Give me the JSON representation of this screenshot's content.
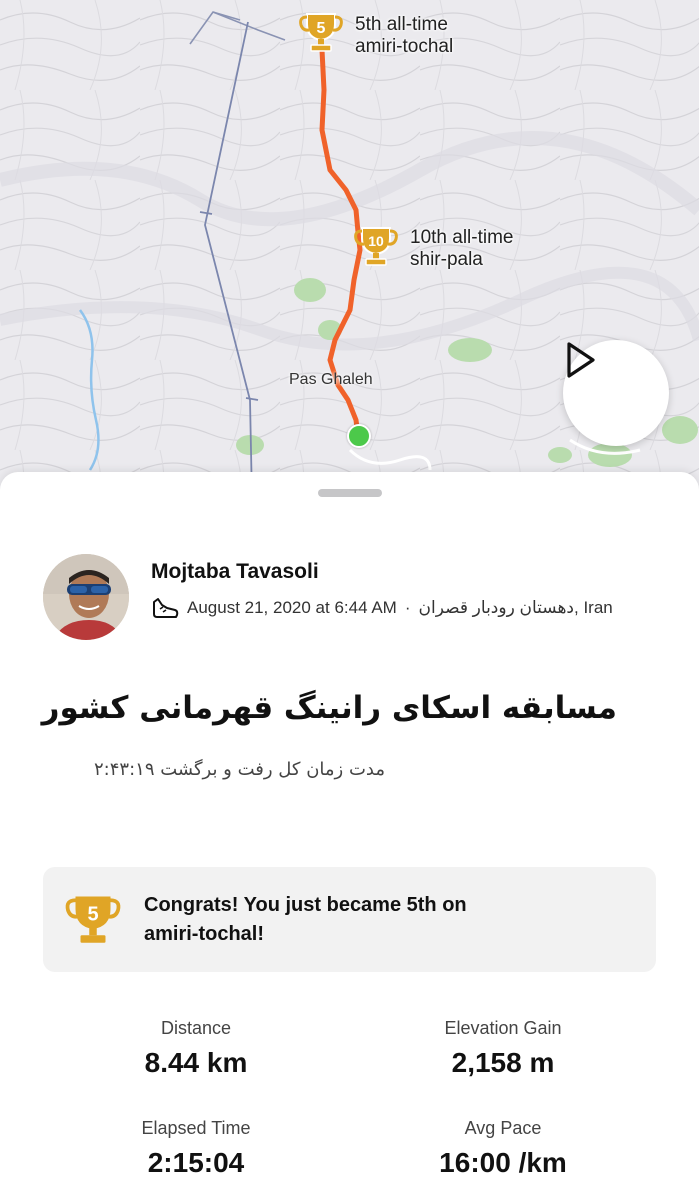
{
  "map": {
    "segments": [
      {
        "rank_badge": "5",
        "rank_text": "5th all-time",
        "segment_name": "amiri-tochal"
      },
      {
        "rank_badge": "10",
        "rank_text": "10th all-time",
        "segment_name": "shir-pala"
      }
    ],
    "place_label": "Pas Ghaleh",
    "route_color": "#f0622a",
    "start_color": "#4cc94a",
    "play_icon": "play-icon"
  },
  "athlete": {
    "name": "Mojtaba Tavasoli",
    "date_time": "August 21, 2020 at 6:44 AM",
    "separator": "·",
    "location": "دهستان رودبار قصران, Iran",
    "activity_icon": "shoe-icon"
  },
  "activity": {
    "title": "مسابقه اسکای رانینگ قهرمانی کشور",
    "description": "مدت زمان کل رفت و برگشت ۲:۴۳:۱۹"
  },
  "achievement": {
    "badge": "5",
    "text": "Congrats! You just became 5th on amiri-tochal!",
    "trophy_color": "#e0a526"
  },
  "stats": [
    {
      "label": "Distance",
      "value": "8.44 km"
    },
    {
      "label": "Elevation Gain",
      "value": "2,158 m"
    },
    {
      "label": "Elapsed Time",
      "value": "2:15:04"
    },
    {
      "label": "Avg Pace",
      "value": "16:00 /km"
    }
  ]
}
